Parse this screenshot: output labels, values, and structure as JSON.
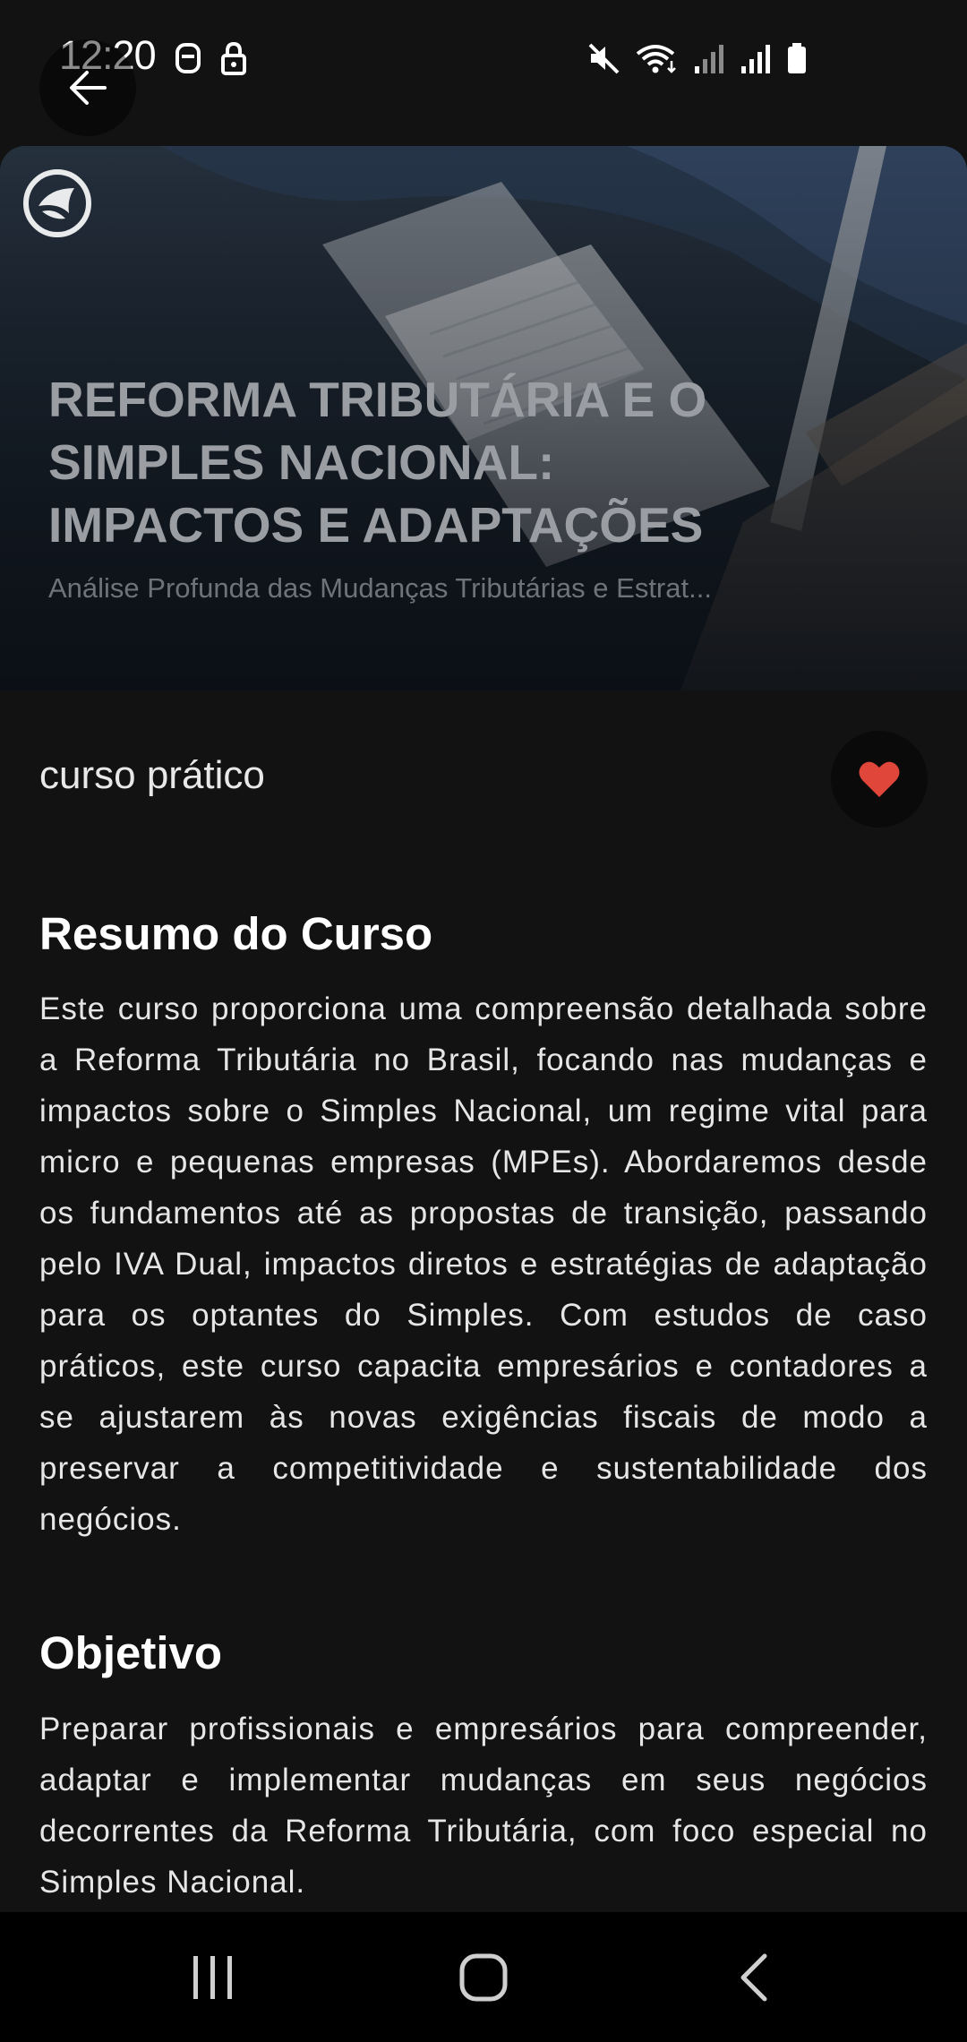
{
  "status_bar": {
    "time": "12:20"
  },
  "hero": {
    "title": "REFORMA TRIBUTÁRIA E O SIMPLES NACIONAL: IMPACTOS E ADAPTAÇÕES",
    "subtitle": "Análise Profunda das Mudanças Tributárias e Estrat..."
  },
  "course": {
    "type": "curso prático",
    "favorite_color": "#e0463a"
  },
  "summary": {
    "title": "Resumo do Curso",
    "text": "Este curso proporciona uma compreensão detalhada sobre a Reforma Tributária no Brasil, focando nas mudanças e impactos sobre o Simples Nacional, um regime vital para micro e pequenas empresas (MPEs). Abordaremos desde os fundamentos até as propostas de transição, passando pelo IVA Dual, impactos diretos e estratégias de adaptação para os optantes do Simples. Com estudos de caso práticos, este curso capacita empresários e contadores a se ajustarem às novas exigências fiscais de modo a preservar a competitividade e sustentabilidade dos negócios."
  },
  "objective": {
    "title": "Objetivo",
    "text": "Preparar profissionais e empresários para compreender, adaptar e implementar mudanças em seus negócios decorrentes da Reforma Tributária, com foco especial no Simples Nacional."
  },
  "icons": {
    "back": "arrow-left-icon",
    "favorite": "heart-icon",
    "logo": "brand-logo-icon",
    "nav_recents": "recents-icon",
    "nav_home": "home-icon",
    "nav_back": "chevron-left-icon"
  }
}
